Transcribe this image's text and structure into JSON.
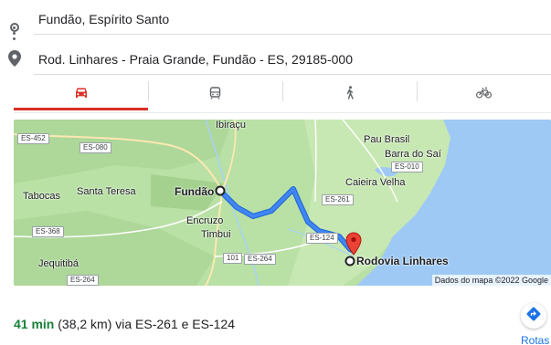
{
  "route": {
    "origin": "Fundão, Espírito Santo",
    "destination": "Rod. Linhares - Praia Grande, Fundão - ES, 29185-000"
  },
  "modes": [
    {
      "icon": "car-icon",
      "active": true
    },
    {
      "icon": "transit-icon",
      "active": false
    },
    {
      "icon": "walk-icon",
      "active": false
    },
    {
      "icon": "bicycle-icon",
      "active": false
    }
  ],
  "map": {
    "places": {
      "ibiracu": "Ibiraçu",
      "pau_brasil": "Pau Brasil",
      "barra_do_sai": "Barra do Saí",
      "caieira_velha": "Caieira Velha",
      "santa_teresa": "Santa Teresa",
      "tabocas": "Tabocas",
      "fundao": "Fundão",
      "encruzo": "Encruzo",
      "timbui": "Timbui",
      "jequitiba": "Jequitibá",
      "rodovia_linhares": "Rodovia Linhares"
    },
    "shields": {
      "es452": "ES-452",
      "es080": "ES-080",
      "es010": "ES-010",
      "es261": "ES-261",
      "es368": "ES-368",
      "es124": "ES-124",
      "r101": "101",
      "es264a": "ES-264",
      "es264b": "ES-264"
    },
    "credit": "Dados do mapa ©2022 Google",
    "colors": {
      "land": "#b9e0a5",
      "water": "#9ec9f5",
      "route": "#1a73e8",
      "pin": "#ea4335"
    }
  },
  "summary": {
    "time": "41 min",
    "details": " (38,2 km) via ES-261 e ES-124",
    "button_label": "Rotas"
  }
}
